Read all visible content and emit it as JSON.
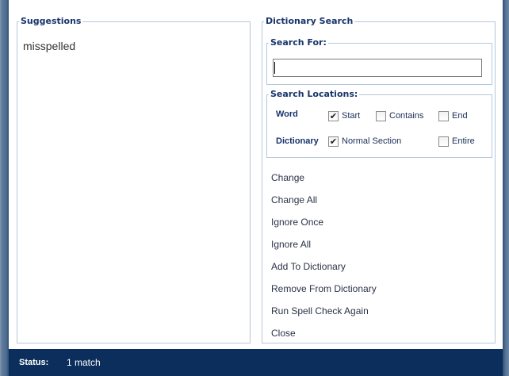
{
  "suggestions": {
    "legend": "Suggestions",
    "items": [
      "misspelled"
    ]
  },
  "dictionary_search": {
    "legend": "Dictionary Search",
    "search_for": {
      "legend": "Search For:",
      "value": ""
    },
    "search_locations": {
      "legend": "Search Locations:",
      "word_label": "Word",
      "dictionary_label": "Dictionary",
      "options": {
        "start": {
          "label": "Start",
          "checked": true
        },
        "contains": {
          "label": "Contains",
          "checked": false
        },
        "end": {
          "label": "End",
          "checked": false
        },
        "normal_section": {
          "label": "Normal Section",
          "checked": true
        },
        "entire": {
          "label": "Entire",
          "checked": false
        }
      }
    }
  },
  "actions": [
    "Change",
    "Change All",
    "Ignore Once",
    "Ignore All",
    "Add To Dictionary",
    "Remove From Dictionary",
    "Run Spell Check Again",
    "Close"
  ],
  "status": {
    "label": "Status:",
    "value": "1 match"
  },
  "colors": {
    "legend_text": "#16346b",
    "status_bar": "#0b2e5c",
    "panel_border": "#b3c8db"
  }
}
